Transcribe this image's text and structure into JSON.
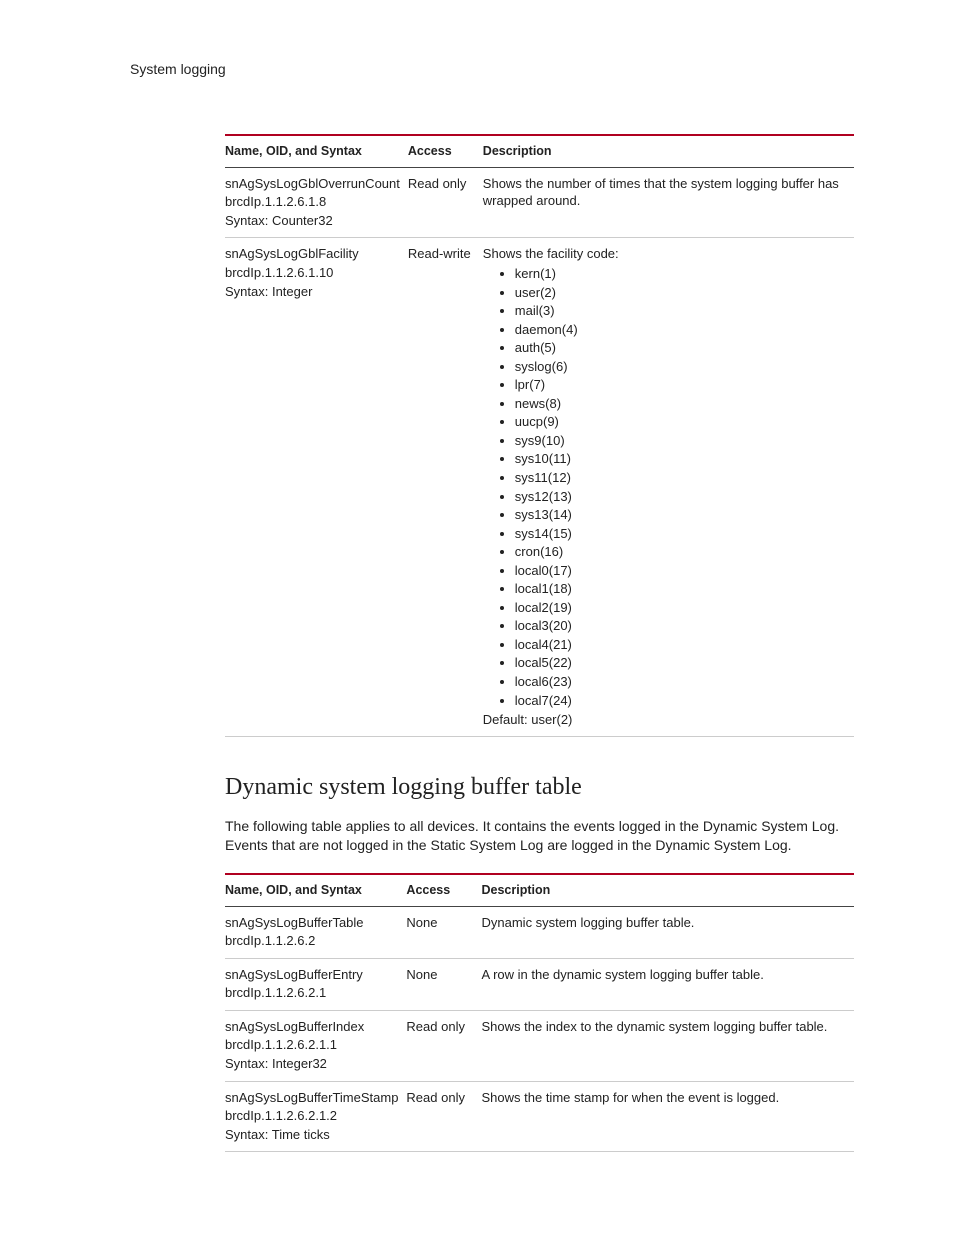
{
  "header": {
    "title": "System logging"
  },
  "table1": {
    "cols": {
      "name": "Name, OID, and Syntax",
      "access": "Access",
      "desc": "Description"
    },
    "rows": [
      {
        "name1": "snAgSysLogGblOverrunCount",
        "name2": "brcdIp.1.1.2.6.1.8",
        "name3": "Syntax: Counter32",
        "access": "Read only",
        "desc": "Shows the number of times that the system logging buffer has wrapped around."
      },
      {
        "name1": "snAgSysLogGblFacility",
        "name2": "brcdIp.1.1.2.6.1.10",
        "name3": "Syntax: Integer",
        "access": "Read-write",
        "desc_intro": "Shows the facility code:",
        "facilities": [
          "kern(1)",
          "user(2)",
          "mail(3)",
          "daemon(4)",
          "auth(5)",
          "syslog(6)",
          "lpr(7)",
          "news(8)",
          "uucp(9)",
          "sys9(10)",
          "sys10(11)",
          "sys11(12)",
          "sys12(13)",
          "sys13(14)",
          "sys14(15)",
          "cron(16)",
          "local0(17)",
          "local1(18)",
          "local2(19)",
          "local3(20)",
          "local4(21)",
          "local5(22)",
          "local6(23)",
          "local7(24)"
        ],
        "desc_default": "Default: user(2)"
      }
    ]
  },
  "section": {
    "heading": "Dynamic system logging buffer table",
    "intro": "The following table applies to all devices. It contains the events logged in the Dynamic System Log. Events that are not logged in the Static System Log are logged in the Dynamic System Log."
  },
  "table2": {
    "cols": {
      "name": "Name, OID, and Syntax",
      "access": "Access",
      "desc": "Description"
    },
    "rows": [
      {
        "name1": "snAgSysLogBufferTable",
        "name2": "brcdIp.1.1.2.6.2",
        "name3": "",
        "access": "None",
        "desc": "Dynamic system logging buffer table."
      },
      {
        "name1": "snAgSysLogBufferEntry",
        "name2": "brcdIp.1.1.2.6.2.1",
        "name3": "",
        "access": "None",
        "desc": "A row in the dynamic system logging buffer table."
      },
      {
        "name1": "snAgSysLogBufferIndex",
        "name2": "brcdIp.1.1.2.6.2.1.1",
        "name3": "Syntax: Integer32",
        "access": "Read only",
        "desc": "Shows the index to the dynamic system logging buffer table."
      },
      {
        "name1": "snAgSysLogBufferTimeStamp",
        "name2": "brcdIp.1.1.2.6.2.1.2",
        "name3": "Syntax: Time ticks",
        "access": "Read only",
        "desc": "Shows the time stamp for when the event is logged."
      }
    ]
  }
}
